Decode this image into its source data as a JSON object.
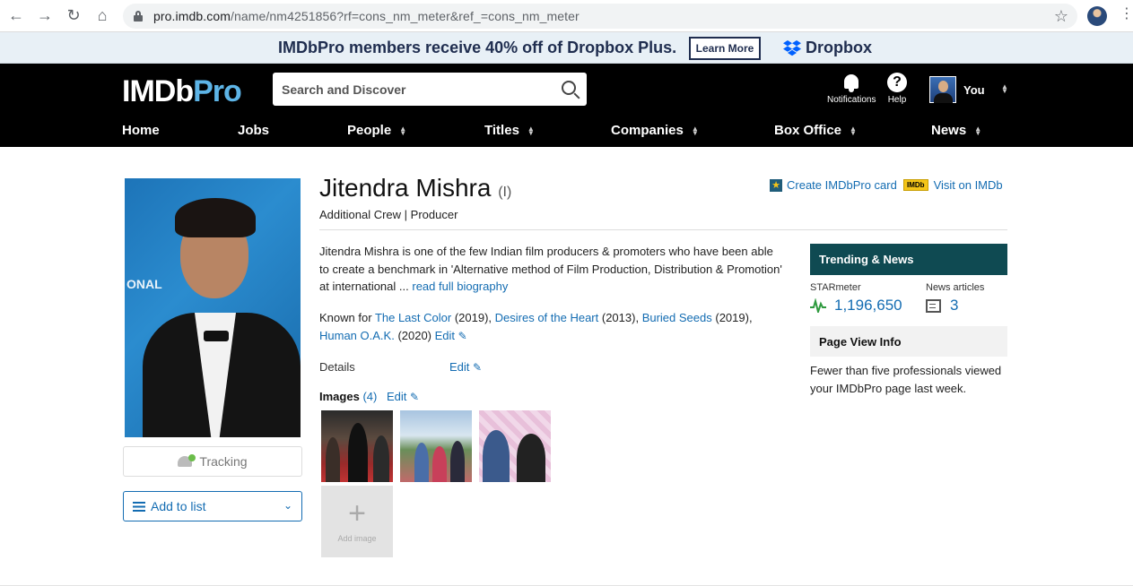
{
  "browser": {
    "url_host": "pro.imdb.com",
    "url_path": "/name/nm4251856?rf=cons_nm_meter&ref_=cons_nm_meter",
    "icons": [
      "back-arrow-icon",
      "forward-arrow-icon",
      "reload-icon",
      "home-icon",
      "lock-icon",
      "bookmark-star-icon",
      "profile-avatar-icon",
      "kebab-menu-icon"
    ]
  },
  "promo": {
    "text": "IMDbPro members receive 40% off of Dropbox Plus.",
    "button": "Learn More",
    "brand": "Dropbox"
  },
  "header": {
    "logo_main": "IMDb",
    "logo_pro": "Pro",
    "search_placeholder": "Search and Discover",
    "notifications": "Notifications",
    "help": "Help",
    "help_glyph": "?",
    "user": "You"
  },
  "nav": {
    "items": [
      "Home",
      "Jobs",
      "People",
      "Titles",
      "Companies",
      "Box Office",
      "News"
    ]
  },
  "profile": {
    "name": "Jitendra Mishra",
    "disambiguation": "(I)",
    "roles": "Additional Crew | Producer",
    "create_card": "Create IMDbPro card",
    "imdb_badge": "IMDb",
    "visit_imdb": "Visit on IMDb",
    "bio": "Jitendra Mishra is one of the few Indian film producers & promoters who have been able to create a benchmark in 'Alternative method of Film Production, Distribution & Promotion' at international ...",
    "read_bio": "read full biography",
    "known_for_label": "Known for",
    "known_for": [
      {
        "title": "The Last Color",
        "year": "(2019)"
      },
      {
        "title": "Desires of the Heart",
        "year": "(2013)"
      },
      {
        "title": "Buried Seeds",
        "year": "(2019)"
      },
      {
        "title": "Human O.A.K.",
        "year": "(2020)"
      }
    ],
    "edit": "Edit",
    "details_label": "Details",
    "images_label": "Images",
    "images_count": "(4)",
    "add_image": "Add image",
    "tracking": "Tracking",
    "add_to_list": "Add to list",
    "photo_text": "ONAL"
  },
  "sidebar": {
    "trending_title": "Trending & News",
    "starmeter_label": "STARmeter",
    "starmeter_value": "1,196,650",
    "news_label": "News articles",
    "news_value": "3",
    "page_view_title": "Page View Info",
    "page_view_text": "Fewer than five professionals viewed your IMDbPro page last week."
  },
  "colors": {
    "accent_link": "#136cb2",
    "header_bg": "#000000",
    "trending_bg": "#0f4a52",
    "logo_pro": "#5db4e6",
    "imdb_yellow": "#f5c518"
  }
}
